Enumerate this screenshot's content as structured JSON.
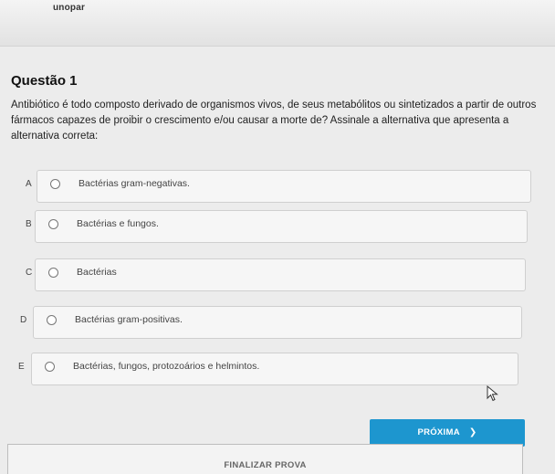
{
  "header": {
    "brand": "unopar"
  },
  "question": {
    "title": "Questão 1",
    "text": "Antibiótico é todo composto derivado de organismos vivos, de seus metabólitos ou sintetizados a partir de outros fármacos capazes de proibir o crescimento e/ou causar a morte de? Assinale a alternativa que apresenta a alternativa correta:"
  },
  "options": [
    {
      "letter": "A",
      "text": "Bactérias gram-negativas."
    },
    {
      "letter": "B",
      "text": "Bactérias e fungos."
    },
    {
      "letter": "C",
      "text": "Bactérias"
    },
    {
      "letter": "D",
      "text": "Bactérias gram-positivas."
    },
    {
      "letter": "E",
      "text": "Bactérias, fungos, protozoários e helmintos."
    }
  ],
  "actions": {
    "next_label": "PRÓXIMA",
    "next_icon": "chevron-right-icon",
    "finish_label": "FINALIZAR PROVA"
  },
  "colors": {
    "accent": "#1d96cf",
    "background": "#ececec"
  }
}
